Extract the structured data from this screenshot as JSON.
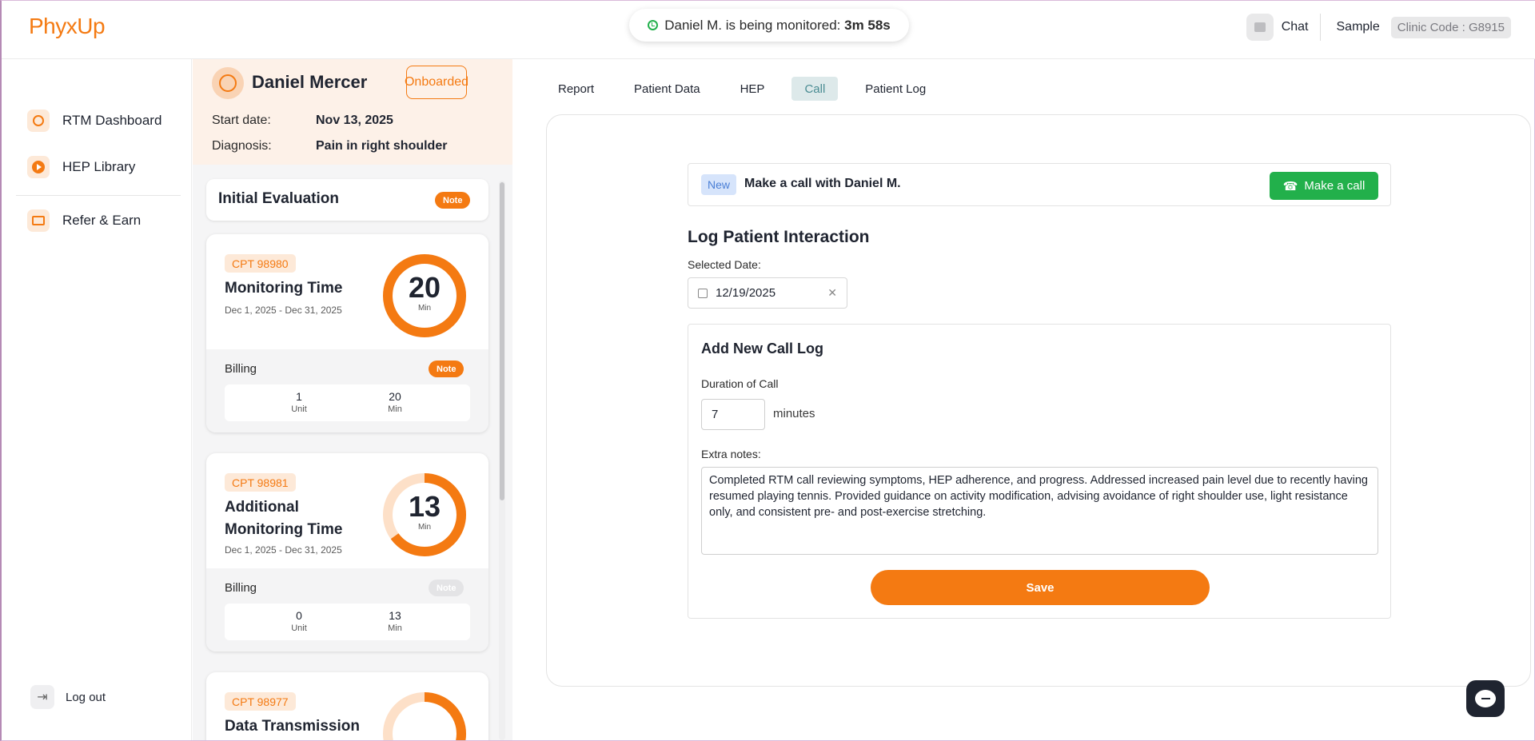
{
  "brand": {
    "logo_text": "PhyxUp",
    "accent": "#f47a12"
  },
  "monitor": {
    "prefix": "Daniel M. is being monitored: ",
    "elapsed": "3m 58s"
  },
  "top_right": {
    "chat_label": "Chat",
    "sample_label": "Sample",
    "clinic_code": "Clinic Code : G8915"
  },
  "sidebar": {
    "items": [
      {
        "label": "RTM Dashboard",
        "icon": "user-circle-icon"
      },
      {
        "label": "HEP Library",
        "icon": "play-icon"
      },
      {
        "label": "Refer & Earn",
        "icon": "ticket-icon"
      }
    ],
    "logout_label": "Log out"
  },
  "patient": {
    "name": "Daniel Mercer",
    "status": "Onboarded",
    "start_label": "Start date:",
    "start_value": "Nov 13, 2025",
    "diagnosis_label": "Diagnosis:",
    "diagnosis_value": "Pain in right shoulder"
  },
  "initial_eval": {
    "title": "Initial Evaluation",
    "note_label": "Note"
  },
  "cpt_cards": [
    {
      "code": "CPT 98980",
      "title": "Monitoring Time",
      "range": "Dec 1, 2025 - Dec 31, 2025",
      "minutes": "20",
      "minutes_unit": "Min",
      "progress": 1.0,
      "billing_label": "Billing",
      "note_label": "Note",
      "note_enabled": true,
      "units": "1",
      "units_label": "Unit",
      "billed_min": "20",
      "billed_min_label": "Min"
    },
    {
      "code": "CPT 98981",
      "title": "Additional Monitoring Time",
      "range": "Dec 1, 2025 - Dec 31, 2025",
      "minutes": "13",
      "minutes_unit": "Min",
      "progress": 0.65,
      "billing_label": "Billing",
      "note_label": "Note",
      "note_enabled": false,
      "units": "0",
      "units_label": "Unit",
      "billed_min": "13",
      "billed_min_label": "Min"
    },
    {
      "code": "CPT 98977",
      "title": "Data Transmission",
      "progress": 0.3
    }
  ],
  "tabs": [
    {
      "label": "Report",
      "active": false
    },
    {
      "label": "Patient Data",
      "active": false
    },
    {
      "label": "HEP",
      "active": false
    },
    {
      "label": "Call",
      "active": true
    },
    {
      "label": "Patient Log",
      "active": false
    }
  ],
  "call": {
    "badge": "New",
    "text": "Make a call with Daniel M.",
    "button_label": "Make a call",
    "button_color": "#22b04b"
  },
  "log": {
    "title": "Log Patient Interaction",
    "date_label": "Selected Date:",
    "date_value": "12/19/2025",
    "panel_title": "Add New Call Log",
    "duration_label": "Duration of Call",
    "duration_value": "7",
    "duration_unit": "minutes",
    "notes_label": "Extra notes:",
    "notes_value": "Completed RTM call reviewing symptoms, HEP adherence, and progress. Addressed increased pain level due to recently having resumed playing tennis. Provided guidance on activity modification, advising avoidance of right shoulder use, light resistance only, and consistent pre- and post-exercise stretching.",
    "save_label": "Save"
  }
}
